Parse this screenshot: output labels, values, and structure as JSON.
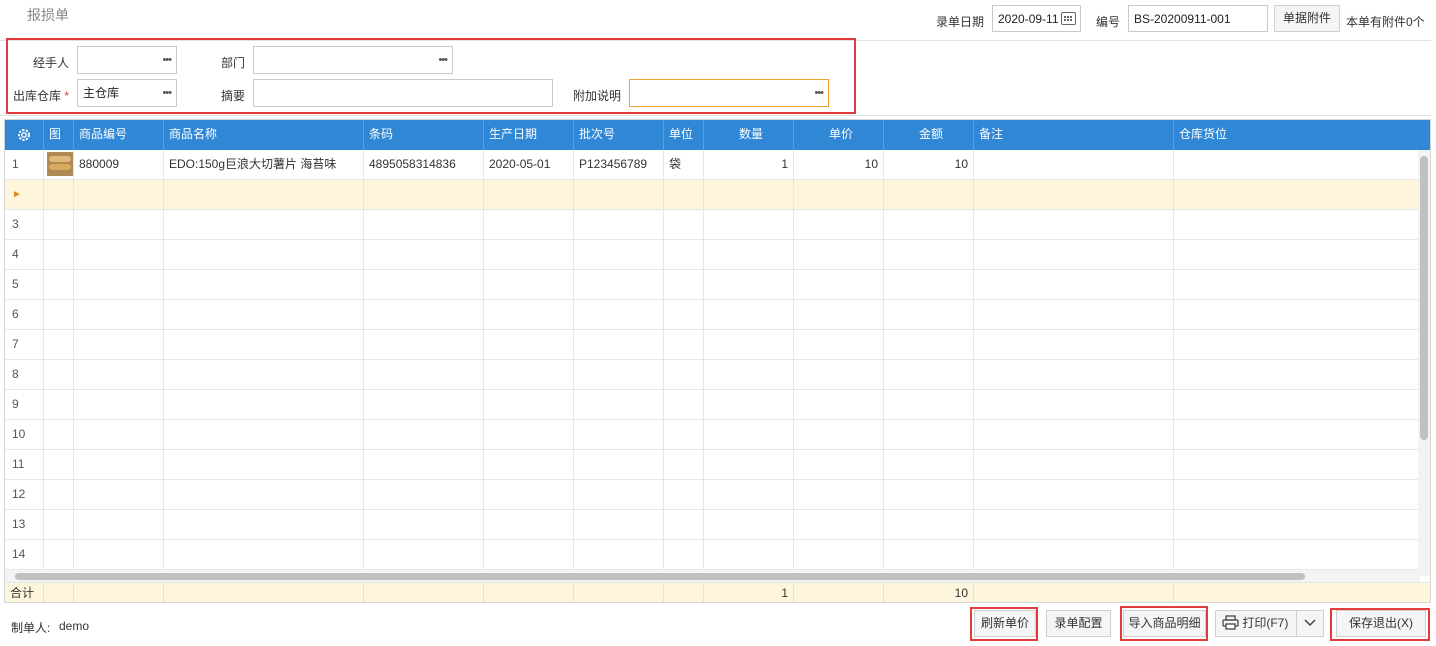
{
  "title": "报损单",
  "header": {
    "date_label": "录单日期",
    "date_value": "2020-09-11",
    "no_label": "编号",
    "no_value": "BS-20200911-001",
    "attach_button": "单据附件",
    "attach_info": "本单有附件0个"
  },
  "form": {
    "handler_label": "经手人",
    "handler_value": "",
    "dept_label": "部门",
    "dept_value": "",
    "warehouse_label": "出库仓库",
    "required_mark": "*",
    "warehouse_value": "主仓库",
    "summary_label": "摘要",
    "summary_value": "",
    "note_label": "附加说明",
    "note_value": "",
    "ellipsis": "•••"
  },
  "grid": {
    "columns": [
      "图",
      "商品编号",
      "商品名称",
      "条码",
      "生产日期",
      "批次号",
      "单位",
      "数量",
      "单价",
      "金额",
      "备注",
      "仓库货位"
    ],
    "rows": [
      {
        "num": "1",
        "code": "880009",
        "name": "EDO:150g巨浪大切薯片 海苔味",
        "barcode": "4895058314836",
        "date": "2020-05-01",
        "batch": "P123456789",
        "unit": "袋",
        "qty": "1",
        "price": "10",
        "amount": "10",
        "remark": "",
        "location": ""
      }
    ],
    "active_marker": "►",
    "row_numbers": [
      "3",
      "4",
      "5",
      "6",
      "7",
      "8",
      "9",
      "10",
      "11",
      "12",
      "13",
      "14"
    ],
    "total_label": "合计",
    "total_qty": "1",
    "total_amount": "10"
  },
  "footer": {
    "creator_label": "制单人:",
    "creator_value": "demo",
    "refresh_price": "刷新单价",
    "entry_config": "录单配置",
    "import_detail": "导入商品明细",
    "print": "打印(F7)",
    "save_exit": "保存退出(X)"
  }
}
